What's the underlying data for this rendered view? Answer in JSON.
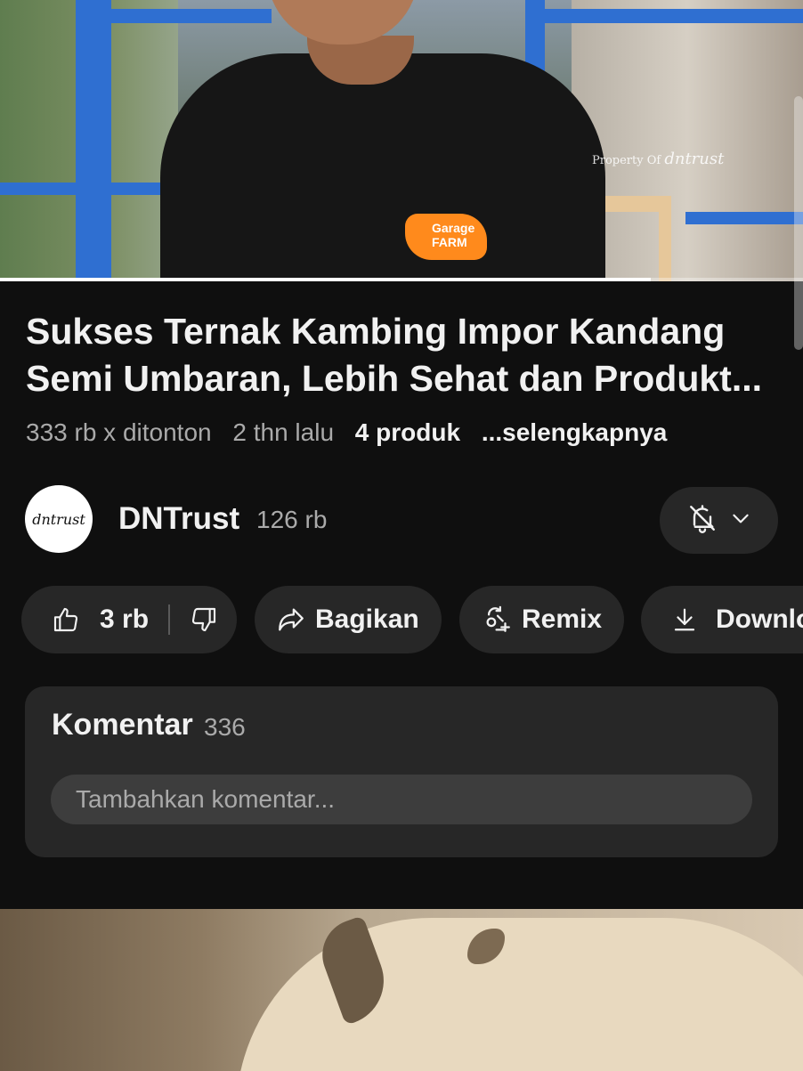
{
  "video": {
    "watermark_prefix": "Property Of",
    "watermark_brand": "dntrust",
    "shirt_logo_line1": "Garage",
    "shirt_logo_line2": "FARM",
    "progress_fraction": 0.81
  },
  "title": "Sukses Ternak Kambing Impor Kandang Semi Umbaran, Lebih Sehat dan Produkt...",
  "meta": {
    "views": "333 rb x ditonton",
    "age": "2 thn lalu",
    "products": "4 produk",
    "more": "...selengkapnya"
  },
  "channel": {
    "avatar_text": "dntrust",
    "name": "DNTrust",
    "subscribers": "126 rb"
  },
  "actions": {
    "likes": "3 rb",
    "share": "Bagikan",
    "remix": "Remix",
    "download": "Download"
  },
  "comments": {
    "title": "Komentar",
    "count": "336",
    "placeholder": "Tambahkan komentar..."
  },
  "colors": {
    "background": "#0f0f0f",
    "surface": "#272727",
    "text": "#f1f1f1",
    "secondary_text": "#aaaaaa"
  }
}
